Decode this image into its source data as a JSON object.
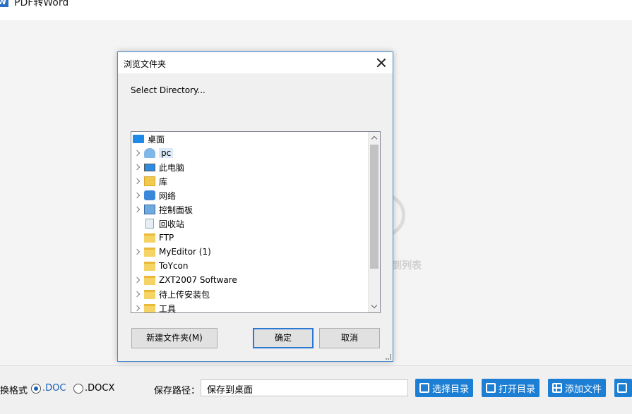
{
  "app": {
    "title": "PDF转Word",
    "logo_letter": "W",
    "drop_hint": "到列表"
  },
  "bottom_bar": {
    "format_label": "换格式",
    "formats": [
      {
        "label": ".DOC",
        "selected": true
      },
      {
        "label": ".DOCX",
        "selected": false
      }
    ],
    "save_path_label": "保存路径：",
    "save_path_value": "保存到桌面",
    "buttons": {
      "select_dir": "选择目录",
      "open_dir": "打开目录",
      "add_file": "添加文件"
    }
  },
  "dialog": {
    "title": "浏览文件夹",
    "description": "Select Directory...",
    "tree": [
      {
        "label": "桌面",
        "icon": "desktop-icon",
        "expandable": false,
        "selected": false,
        "level": 0
      },
      {
        "label": "pc",
        "icon": "user-icon",
        "expandable": true,
        "selected": true,
        "level": 1
      },
      {
        "label": "此电脑",
        "icon": "computer-icon",
        "expandable": true,
        "selected": false,
        "level": 1
      },
      {
        "label": "库",
        "icon": "library-icon",
        "expandable": true,
        "selected": false,
        "level": 1
      },
      {
        "label": "网络",
        "icon": "network-icon",
        "expandable": true,
        "selected": false,
        "level": 1
      },
      {
        "label": "控制面板",
        "icon": "control-panel-icon",
        "expandable": true,
        "selected": false,
        "level": 1
      },
      {
        "label": "回收站",
        "icon": "recycle-bin-icon",
        "expandable": false,
        "selected": false,
        "level": 1
      },
      {
        "label": "FTP",
        "icon": "folder-icon",
        "expandable": false,
        "selected": false,
        "level": 1
      },
      {
        "label": "MyEditor (1)",
        "icon": "folder-icon",
        "expandable": true,
        "selected": false,
        "level": 1
      },
      {
        "label": "ToYcon",
        "icon": "folder-icon",
        "expandable": false,
        "selected": false,
        "level": 1
      },
      {
        "label": "ZXT2007 Software",
        "icon": "folder-icon",
        "expandable": true,
        "selected": false,
        "level": 1
      },
      {
        "label": "待上传安装包",
        "icon": "folder-icon",
        "expandable": true,
        "selected": false,
        "level": 1
      },
      {
        "label": "工具",
        "icon": "folder-icon",
        "expandable": true,
        "selected": false,
        "level": 1
      }
    ],
    "buttons": {
      "new_folder": "新建文件夹(M)",
      "ok": "确定",
      "cancel": "取消"
    }
  },
  "colors": {
    "accent": "#1c7fd4",
    "dialog_border": "#4a8ad0",
    "selected_bg": "#dbe9f8"
  }
}
